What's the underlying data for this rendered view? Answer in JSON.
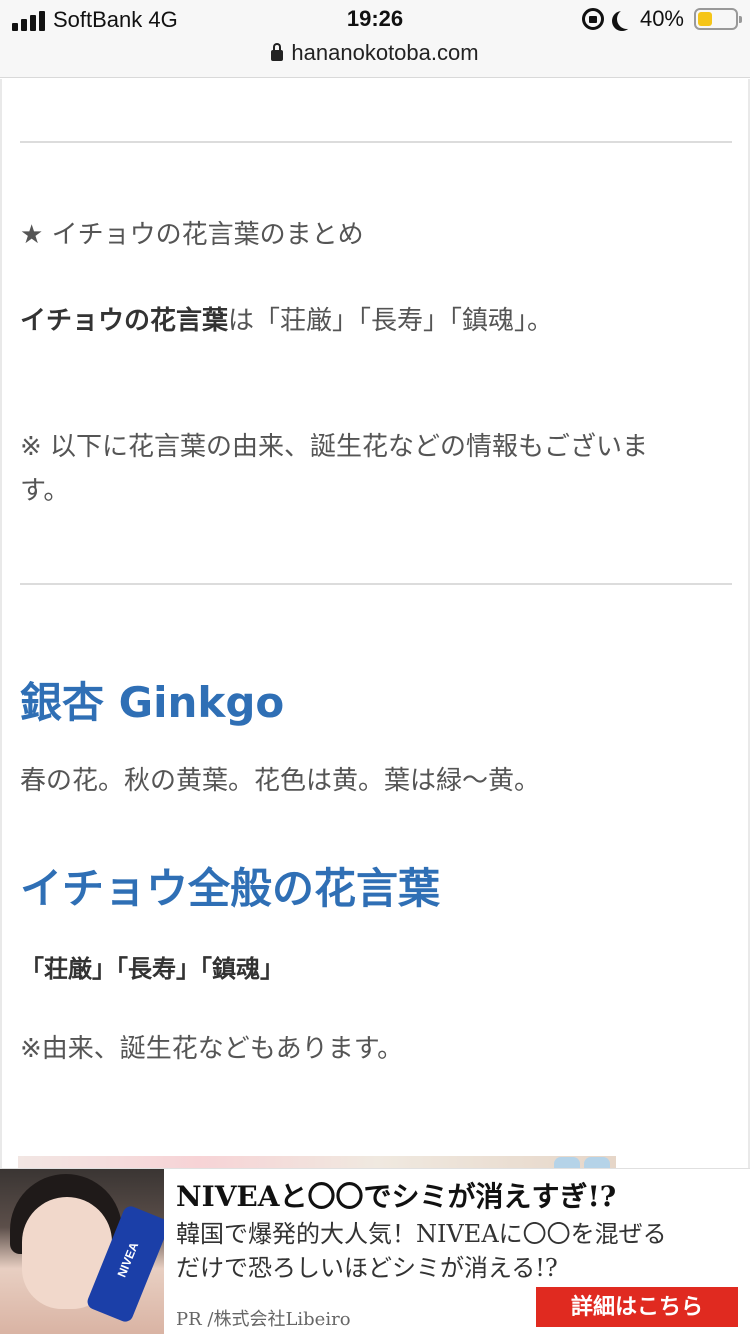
{
  "status_bar": {
    "carrier": "SoftBank 4G",
    "time": "19:26",
    "battery_percent": "40%",
    "battery_level": 0.4,
    "url": "hananokotoba.com"
  },
  "article": {
    "summary_heading": "★ イチョウの花言葉のまとめ",
    "summary_bold": "イチョウの花言葉",
    "summary_rest": "は「荘厳」「長寿」「鎮魂」。",
    "note_line1": "※ 以下に花言葉の由来、誕生花などの情報もございま",
    "note_line2": "す。",
    "title": "銀杏 Ginkgo",
    "description": "春の花。秋の黄葉。花色は黄。葉は緑～黄。",
    "section_heading": "イチョウ全般の花言葉",
    "meanings": "「荘厳」「長寿」「鎮魂」",
    "footnote": "※由来、誕生花などもあります。"
  },
  "ad_banner": {
    "title": "NIVEAと〇〇でシミが消えすぎ!?",
    "desc_line1": "韓国で爆発的大人気！NIVEAに〇〇を混ぜる",
    "desc_line2": "だけで恐ろしいほどシミが消える!?",
    "pr": "PR /株式会社Libeiro",
    "cta": "詳細はこちら",
    "product_label": "NIVEA"
  },
  "colors": {
    "heading_blue": "#2f6fb5",
    "cta_red": "#e02a20",
    "battery_yellow": "#f5c518"
  }
}
